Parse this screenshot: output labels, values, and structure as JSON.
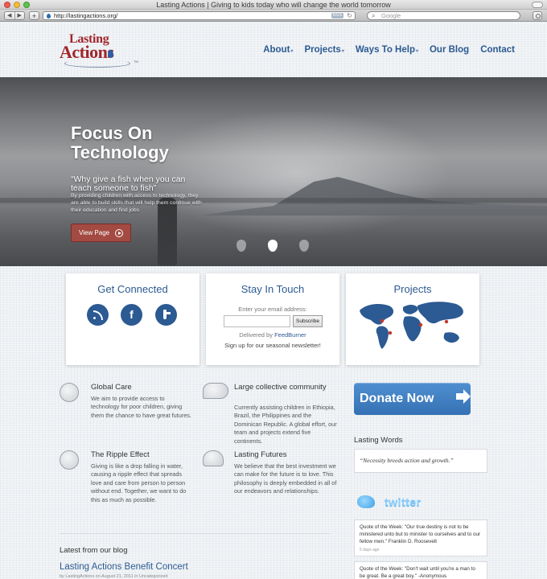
{
  "browser": {
    "window_title": "Lasting Actions | Giving to kids today who will change the world tomorrow",
    "back_glyph": "◀",
    "forward_glyph": "▶",
    "add_glyph": "+",
    "url": "http://lastingactions.org/",
    "rss_badge": "RSS",
    "reload_glyph": "↻",
    "search_placeholder": "Google",
    "search_glyph": "⌕"
  },
  "site": {
    "logo": {
      "line1": "Lasting",
      "line2": "Actions",
      "tm": "TM"
    },
    "nav": [
      {
        "label": "About",
        "dropdown": true
      },
      {
        "label": "Projects",
        "dropdown": true
      },
      {
        "label": "Ways To Help",
        "dropdown": true
      },
      {
        "label": "Our Blog",
        "dropdown": false
      },
      {
        "label": "Contact",
        "dropdown": false
      }
    ],
    "caret": "▾",
    "hero": {
      "title": "Focus On Technology",
      "quote": "“Why give a fish when you can teach someone to fish”",
      "body": "By providing children with access to technology, they are able to build skills that will help them continue with their education and find jobs",
      "button": "View Page",
      "slides": 3,
      "active_slide": 2
    },
    "boxes": {
      "connected": {
        "title": "Get Connected",
        "fb": "f"
      },
      "stay": {
        "title": "Stay In Touch",
        "email_label": "Enter your email address:",
        "subscribe": "Subscribe",
        "delivered_prefix": "Delivered by",
        "delivered_brand": "FeedBurner",
        "signup": "Sign up for our seasonal newsletter!"
      },
      "projects": {
        "title": "Projects"
      }
    },
    "features": [
      {
        "title": "Global Care",
        "text": "We aim to provide access to technology for poor children, giving them the chance to have great futures."
      },
      {
        "title": "Large collective community",
        "text": "Currently assisting children in Ethiopia, Brazil, the Philippines and the Dominican Republic. A global effort, our team and projects extend five continents."
      },
      {
        "title": "The Ripple Effect",
        "text": "Giving is like a drop falling in water, causing a ripple effect that spreads love and care from person to person without end. Together, we want to do this as much as possible."
      },
      {
        "title": "Lasting Futures",
        "text": "We believe that the best investment we can make for the future is to love. This philosophy is deeply embedded in all of our endeavors and relationships."
      }
    ],
    "blog": {
      "heading": "Latest from our blog",
      "post_title": "Lasting Actions Benefit Concert",
      "post_meta": "by LastingActions on August 21, 2011 in Uncategorized"
    },
    "sidebar": {
      "donate": "Donate Now",
      "lasting_words_heading": "Lasting Words",
      "lasting_words_quote": "“Necessity breeds action and growth.”",
      "twitter_word": "twitter",
      "tweets": [
        {
          "text": "Quote of the Week: \"Our true destiny is not to be ministered unto but to minister to ourselves and to our fellow men.\" Franklin D. Roosevelt",
          "time": "5 days ago"
        },
        {
          "text": "Quote of the Week: \"Don't wait until you're a man to be great. Be a great boy.\" -Anonymous",
          "time": ""
        }
      ]
    }
  }
}
